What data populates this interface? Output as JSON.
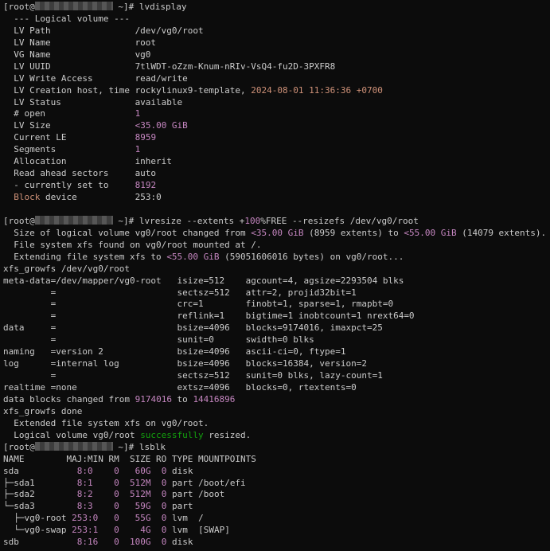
{
  "colors": {
    "background": "#0c0c0c",
    "text": "#cccccc",
    "number_highlight": "#c586c0",
    "date_highlight": "#ce9178",
    "success_highlight": "#13a10e"
  },
  "lines": [
    [
      {
        "t": "[root@"
      },
      {
        "blur": true
      },
      {
        "t": " ~]# lvdisplay"
      }
    ],
    [
      {
        "t": "  --- Logical volume ---"
      }
    ],
    [
      {
        "t": "  LV Path                /dev/vg0/root"
      }
    ],
    [
      {
        "t": "  LV Name                root"
      }
    ],
    [
      {
        "t": "  VG Name                vg0"
      }
    ],
    [
      {
        "t": "  LV UUID                7tlWDT-oZzm-Knum-nRIv-VsQ4-fu2D-3PXFR8"
      }
    ],
    [
      {
        "t": "  LV Write Access        read/write"
      }
    ],
    [
      {
        "t": "  LV Creation host, time rockylinux9-template, "
      },
      {
        "t": "2024-08-01 11:36:36 +0700",
        "c": "date"
      }
    ],
    [
      {
        "t": "  LV Status              available"
      }
    ],
    [
      {
        "t": "  # open                 "
      },
      {
        "t": "1",
        "c": "num"
      }
    ],
    [
      {
        "t": "  LV Size                "
      },
      {
        "t": "<35.00 GiB",
        "c": "num"
      }
    ],
    [
      {
        "t": "  Current LE             "
      },
      {
        "t": "8959",
        "c": "num"
      }
    ],
    [
      {
        "t": "  Segments               "
      },
      {
        "t": "1",
        "c": "num"
      }
    ],
    [
      {
        "t": "  Allocation             inherit"
      }
    ],
    [
      {
        "t": "  Read ahead sectors     auto"
      }
    ],
    [
      {
        "t": "  - currently set to     "
      },
      {
        "t": "8192",
        "c": "num"
      }
    ],
    [
      {
        "t": "  "
      },
      {
        "t": "Block",
        "c": "date"
      },
      {
        "t": " device           253:0"
      }
    ],
    [
      {
        "t": ""
      }
    ],
    [
      {
        "t": "[root@"
      },
      {
        "blur": true
      },
      {
        "t": " ~]# lvresize --extents +"
      },
      {
        "t": "100",
        "c": "num"
      },
      {
        "t": "%FREE --resizefs /dev/vg0/root"
      }
    ],
    [
      {
        "t": "  Size of logical volume vg0/root changed from "
      },
      {
        "t": "<35.00 GiB",
        "c": "num"
      },
      {
        "t": " (8959 extents) to "
      },
      {
        "t": "<55.00 GiB",
        "c": "num"
      },
      {
        "t": " (14079 extents)."
      }
    ],
    [
      {
        "t": "  File system xfs found on vg0/root mounted at /."
      }
    ],
    [
      {
        "t": "  Extending file system xfs to "
      },
      {
        "t": "<55.00 GiB",
        "c": "num"
      },
      {
        "t": " (59051606016 bytes) on vg0/root..."
      }
    ],
    [
      {
        "t": "xfs_growfs /dev/vg0/root"
      }
    ],
    [
      {
        "t": "meta-data=/dev/mapper/vg0-root   isize=512    agcount=4, agsize=2293504 blks"
      }
    ],
    [
      {
        "t": "         =                       sectsz=512   attr=2, projid32bit=1"
      }
    ],
    [
      {
        "t": "         =                       crc=1        finobt=1, sparse=1, rmapbt=0"
      }
    ],
    [
      {
        "t": "         =                       reflink=1    bigtime=1 inobtcount=1 nrext64=0"
      }
    ],
    [
      {
        "t": "data     =                       bsize=4096   blocks=9174016, imaxpct=25"
      }
    ],
    [
      {
        "t": "         =                       sunit=0      swidth=0 blks"
      }
    ],
    [
      {
        "t": "naming   =version 2              bsize=4096   ascii-ci=0, ftype=1"
      }
    ],
    [
      {
        "t": "log      =internal log           bsize=4096   blocks=16384, version=2"
      }
    ],
    [
      {
        "t": "         =                       sectsz=512   sunit=0 blks, lazy-count=1"
      }
    ],
    [
      {
        "t": "realtime =none                   extsz=4096   blocks=0, rtextents=0"
      }
    ],
    [
      {
        "t": "data blocks changed from "
      },
      {
        "t": "9174016",
        "c": "num"
      },
      {
        "t": " to "
      },
      {
        "t": "14416896",
        "c": "num"
      }
    ],
    [
      {
        "t": "xfs_growfs done"
      }
    ],
    [
      {
        "t": "  Extended file system xfs on vg0/root."
      }
    ],
    [
      {
        "t": "  Logical volume vg0/root "
      },
      {
        "t": "successfully",
        "c": "ok"
      },
      {
        "t": " resized."
      }
    ],
    [
      {
        "t": "[root@"
      },
      {
        "blur": true
      },
      {
        "t": " ~]# lsblk"
      }
    ],
    [
      {
        "t": "NAME        MAJ:MIN RM  SIZE RO TYPE MOUNTPOINTS"
      }
    ],
    [
      {
        "t": "sda           "
      },
      {
        "t": "8:0",
        "c": "num"
      },
      {
        "t": "    "
      },
      {
        "t": "0",
        "c": "num"
      },
      {
        "t": "   "
      },
      {
        "t": "60G",
        "c": "num"
      },
      {
        "t": "  "
      },
      {
        "t": "0",
        "c": "num"
      },
      {
        "t": " disk"
      }
    ],
    [
      {
        "t": "├─sda1        "
      },
      {
        "t": "8:1",
        "c": "num"
      },
      {
        "t": "    "
      },
      {
        "t": "0",
        "c": "num"
      },
      {
        "t": "  "
      },
      {
        "t": "512M",
        "c": "num"
      },
      {
        "t": "  "
      },
      {
        "t": "0",
        "c": "num"
      },
      {
        "t": " part /boot/efi"
      }
    ],
    [
      {
        "t": "├─sda2        "
      },
      {
        "t": "8:2",
        "c": "num"
      },
      {
        "t": "    "
      },
      {
        "t": "0",
        "c": "num"
      },
      {
        "t": "  "
      },
      {
        "t": "512M",
        "c": "num"
      },
      {
        "t": "  "
      },
      {
        "t": "0",
        "c": "num"
      },
      {
        "t": " part /boot"
      }
    ],
    [
      {
        "t": "└─sda3        "
      },
      {
        "t": "8:3",
        "c": "num"
      },
      {
        "t": "    "
      },
      {
        "t": "0",
        "c": "num"
      },
      {
        "t": "   "
      },
      {
        "t": "59G",
        "c": "num"
      },
      {
        "t": "  "
      },
      {
        "t": "0",
        "c": "num"
      },
      {
        "t": " part"
      }
    ],
    [
      {
        "t": "  ├─vg0-root "
      },
      {
        "t": "253:0",
        "c": "num"
      },
      {
        "t": "   "
      },
      {
        "t": "0",
        "c": "num"
      },
      {
        "t": "   "
      },
      {
        "t": "55G",
        "c": "num"
      },
      {
        "t": "  "
      },
      {
        "t": "0",
        "c": "num"
      },
      {
        "t": " lvm  /"
      }
    ],
    [
      {
        "t": "  └─vg0-swap "
      },
      {
        "t": "253:1",
        "c": "num"
      },
      {
        "t": "   "
      },
      {
        "t": "0",
        "c": "num"
      },
      {
        "t": "    "
      },
      {
        "t": "4G",
        "c": "num"
      },
      {
        "t": "  "
      },
      {
        "t": "0",
        "c": "num"
      },
      {
        "t": " lvm  [SWAP]"
      }
    ],
    [
      {
        "t": "sdb           "
      },
      {
        "t": "8:16",
        "c": "num"
      },
      {
        "t": "   "
      },
      {
        "t": "0",
        "c": "num"
      },
      {
        "t": "  "
      },
      {
        "t": "100G",
        "c": "num"
      },
      {
        "t": "  "
      },
      {
        "t": "0",
        "c": "num"
      },
      {
        "t": " disk"
      }
    ]
  ]
}
